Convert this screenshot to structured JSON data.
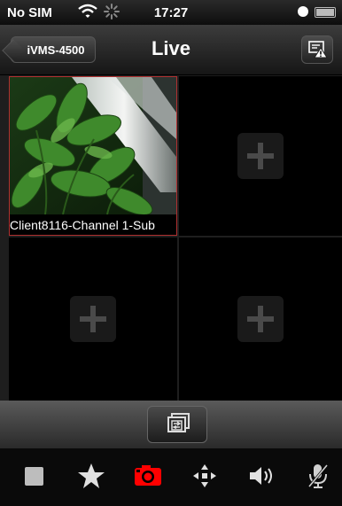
{
  "status_bar": {
    "carrier": "No SIM",
    "time": "17:27"
  },
  "nav_bar": {
    "back_label": "iVMS-4500",
    "title": "Live"
  },
  "grid": {
    "channels": [
      {
        "caption": "Client8116-Channel 1-Sub",
        "active": true
      },
      {
        "caption": "",
        "active": false
      },
      {
        "caption": "",
        "active": false
      },
      {
        "caption": "",
        "active": false
      }
    ]
  },
  "toolbar": {
    "items": [
      "stop-icon",
      "star-icon",
      "camera-icon",
      "ptz-icon",
      "speaker-icon",
      "microphone-icon"
    ],
    "active_item": "camera-icon",
    "active_color": "#ff0000"
  },
  "colors": {
    "selected_border": "#b03030",
    "placeholder_plus": "#4a4a4a"
  }
}
